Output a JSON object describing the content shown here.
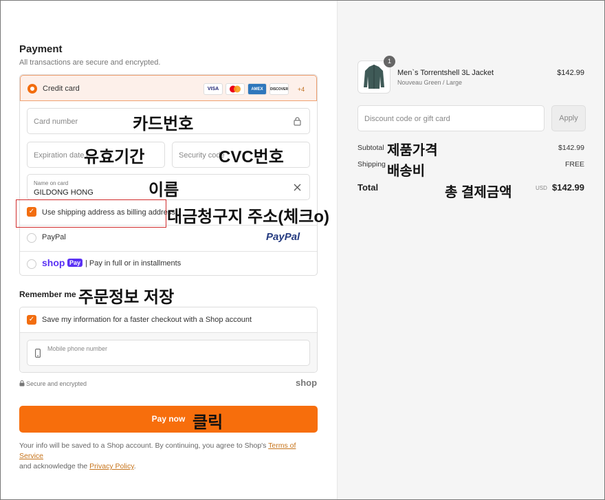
{
  "payment": {
    "title": "Payment",
    "subtitle": "All transactions are secure and encrypted.",
    "credit_card_label": "Credit card",
    "card_brands": [
      "VISA",
      "MC",
      "AMEX",
      "DISCOVER"
    ],
    "more_brands": "+4",
    "card_number_placeholder": "Card number",
    "expiration_placeholder": "Expiration date (",
    "security_placeholder": "Security code",
    "name_label": "Name on card",
    "name_value": "GILDONG HONG",
    "billing_checkbox_label": "Use shipping address as billing address",
    "paypal_label": "PayPal",
    "paypal_logo": "PayPal",
    "shoppay_logo": "shop",
    "shoppay_badge": "Pay",
    "shoppay_text": "| Pay in full or in installments"
  },
  "remember": {
    "title": "Remember me",
    "checkbox_label": "Save my information for a faster checkout with a Shop account",
    "mobile_placeholder": "Mobile phone number",
    "secure_text": "Secure and encrypted",
    "shop_logo": "shop"
  },
  "pay_button": "Pay now",
  "footer": {
    "text1": "Your info will be saved to a Shop account. By continuing, you agree to Shop's ",
    "tos": "Terms of Service",
    "text2": "and acknowledge the ",
    "privacy": "Privacy Policy",
    "text3": "."
  },
  "order": {
    "qty_badge": "1",
    "product_name": "Men`s Torrentshell 3L Jacket",
    "product_variant": "Nouveau Green / Large",
    "product_price": "$142.99",
    "discount_placeholder": "Discount code or gift card",
    "apply_label": "Apply",
    "subtotal_label": "Subtotal",
    "subtotal_value": "$142.99",
    "shipping_label": "Shipping",
    "shipping_value": "FREE",
    "total_label": "Total",
    "total_currency": "USD",
    "total_value": "$142.99"
  },
  "annotations": {
    "card_number": "카드번호",
    "expiration": "유효기간",
    "cvc": "CVC번호",
    "name": "이름",
    "billing": "대금청구지 주소(체크o)",
    "remember": "주문정보 저장",
    "click": "클릭",
    "product_price": "제품가격",
    "shipping": "배송비",
    "total": "총 결제금액"
  },
  "colors": {
    "accent": "#f76e0c",
    "annotation_box": "#d12c2c"
  }
}
